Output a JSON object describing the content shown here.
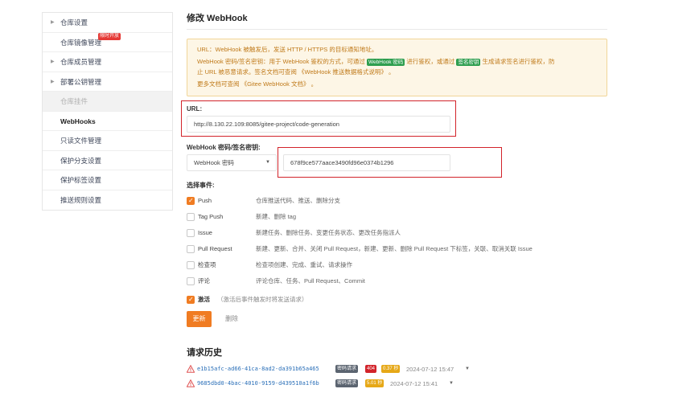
{
  "sidebar": {
    "items": [
      {
        "label": "仓库设置",
        "type": "group"
      },
      {
        "label": "仓库镜像管理",
        "type": "item",
        "badge": "限时开放"
      },
      {
        "label": "仓库成员管理",
        "type": "group"
      },
      {
        "label": "部署公钥管理",
        "type": "group"
      },
      {
        "label": "仓库挂件",
        "type": "disabled"
      },
      {
        "label": "WebHooks",
        "type": "active"
      },
      {
        "label": "只读文件管理",
        "type": "item"
      },
      {
        "label": "保护分支设置",
        "type": "item"
      },
      {
        "label": "保护标签设置",
        "type": "item"
      },
      {
        "label": "推送规则设置",
        "type": "item"
      }
    ]
  },
  "main": {
    "title": "修改 WebHook",
    "notice": {
      "line1": "URL：WebHook 被触发后，发送 HTTP / HTTPS 的目标通知地址。",
      "line2_a": "WebHook 密码/签名密钥：用于 WebHook 鉴权的方式，可通过",
      "tag_password": "WebHook 密码",
      "line2_b": "进行鉴权，或通过",
      "tag_signature": "签名密钥",
      "line2_c": "生成请求签名进行鉴权，防",
      "line3_a": "止 URL 被恶意请求。签名文档可查阅",
      "line3_link": "《WebHook 推送数据格式说明》",
      "line3_b": "。",
      "line4_a": "更多文档可查阅",
      "line4_link": "《Gitee WebHook 文档》",
      "line4_b": "。"
    },
    "url_label": "URL:",
    "url_value": "http://8.130.22.109:8085/gitee-project/code-generation",
    "secret_label": "WebHook 密码/签名密钥:",
    "secret_type": "WebHook 密码",
    "secret_value": "678f9ce577aace3490fd96e0374b1296",
    "events_label": "选择事件:",
    "events": [
      {
        "name": "Push",
        "desc": "仓库推送代码、推送、删除分支",
        "checked": true
      },
      {
        "name": "Tag Push",
        "desc": "新建、删除 tag",
        "checked": false
      },
      {
        "name": "Issue",
        "desc": "新建任务、删除任务、变更任务状态、更改任务指派人",
        "checked": false
      },
      {
        "name": "Pull Request",
        "desc": "新建、更新、合并、关闭 Pull Request，新建、更新、删除 Pull Request 下标签，关联、取消关联 Issue",
        "checked": false
      },
      {
        "name": "检查项",
        "desc": "检查项创建、完成、重试、请求操作",
        "checked": false
      },
      {
        "name": "评论",
        "desc": "评论仓库、任务、Pull Request、Commit",
        "checked": false
      }
    ],
    "activate": {
      "label": "激活",
      "hint": "（激活后事件触发时将发送请求）",
      "checked": true
    },
    "update_button": "更新",
    "delete_button": "删除",
    "history_title": "请求历史",
    "history": [
      {
        "id": "e1b15afc-ad66-41ca-8ad2-da391b65a465",
        "tag": "密码请求",
        "status": "404",
        "duration": "0.37 秒",
        "time": "2024-07-12 15:47"
      },
      {
        "id": "9685dbd0-4bac-4010-9159-d439510a1f6b",
        "tag": "密码请求",
        "status": "",
        "duration": "5.01 秒",
        "time": "2024-07-12 15:41"
      }
    ]
  },
  "colors": {
    "accent": "#f07c22",
    "highlight_border": "#d2232a",
    "notice_bg": "#fdf6e6",
    "notice_text": "#c07a1a",
    "tag_green": "#2e9e4f"
  }
}
